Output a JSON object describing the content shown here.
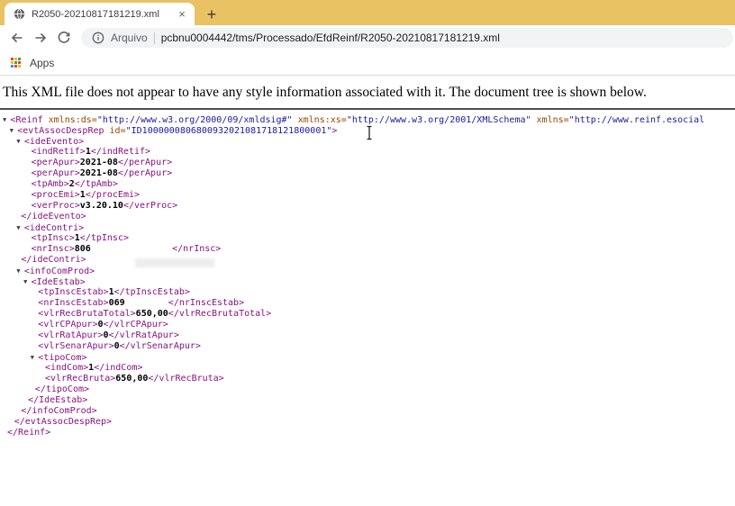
{
  "tab": {
    "title": "R2050-20210817181219.xml",
    "close_glyph": "×",
    "new_tab_glyph": "+"
  },
  "toolbar": {
    "url_scheme_label": "Arquivo",
    "url_path": "pcbnu0004442/tms/Processado/EfdReinf/R2050-20210817181219.xml"
  },
  "bookmarks": {
    "apps_label": "Apps",
    "apps_icon_colors": [
      "#E94335",
      "#FABB05",
      "#34A853",
      "#FABB05",
      "#34A853",
      "#E94335",
      "#4285F4",
      "#E94335",
      "#FABB05"
    ]
  },
  "page": {
    "notice": "This XML file does not appear to have any style information associated with it. The document tree is shown below."
  },
  "theme": {
    "tab_strip_bg": "#E9C264",
    "toolbar_bg": "#FFFFFF",
    "omnibox_bg": "#F1F3F4",
    "divider": "#DADCE0",
    "icon_gray": "#5F6368",
    "url_text": "#202124"
  },
  "xml_tree": {
    "colors": {
      "tag": "#881280",
      "attr_name": "#994500",
      "attr_value": "#1A1AA6",
      "text_node": "#000000"
    },
    "lines": [
      {
        "d": 0,
        "k": "open",
        "arrow": true,
        "p": [
          [
            "tag",
            "<Reinf"
          ],
          [
            "attr",
            " xmlns:ds="
          ],
          [
            "val",
            "\"http://www.w3.org/2000/09/xmldsig#\""
          ],
          [
            "attr",
            " xmlns:xs="
          ],
          [
            "val",
            "\"http://www.w3.org/2001/XMLSchema\""
          ],
          [
            "attr",
            " xmlns="
          ],
          [
            "val",
            "\"http://www.reinf.esocial"
          ]
        ]
      },
      {
        "d": 1,
        "k": "open",
        "arrow": true,
        "p": [
          [
            "tag",
            "<evtAssocDespRep"
          ],
          [
            "attr",
            " id="
          ],
          [
            "val",
            "\"ID1000000806800932021081718121800001\""
          ],
          [
            "tag",
            ">"
          ]
        ]
      },
      {
        "d": 2,
        "k": "open",
        "arrow": true,
        "p": [
          [
            "tag",
            "<ideEvento>"
          ]
        ]
      },
      {
        "d": 3,
        "k": "leaf",
        "p": [
          [
            "tag",
            "<indRetif>"
          ],
          [
            "txt",
            "1"
          ],
          [
            "tag",
            "</indRetif>"
          ]
        ]
      },
      {
        "d": 3,
        "k": "leaf",
        "p": [
          [
            "tag",
            "<perApur>"
          ],
          [
            "txt",
            "2021-08"
          ],
          [
            "tag",
            "</perApur>"
          ]
        ]
      },
      {
        "d": 3,
        "k": "leaf",
        "p": [
          [
            "tag",
            "<perApur>"
          ],
          [
            "txt",
            "2021-08"
          ],
          [
            "tag",
            "</perApur>"
          ]
        ]
      },
      {
        "d": 3,
        "k": "leaf",
        "p": [
          [
            "tag",
            "<tpAmb>"
          ],
          [
            "txt",
            "2"
          ],
          [
            "tag",
            "</tpAmb>"
          ]
        ]
      },
      {
        "d": 3,
        "k": "leaf",
        "p": [
          [
            "tag",
            "<procEmi>"
          ],
          [
            "txt",
            "1"
          ],
          [
            "tag",
            "</procEmi>"
          ]
        ]
      },
      {
        "d": 3,
        "k": "leaf",
        "p": [
          [
            "tag",
            "<verProc>"
          ],
          [
            "txt",
            "v3.20.10"
          ],
          [
            "tag",
            "</verProc>"
          ]
        ]
      },
      {
        "d": 2,
        "k": "close",
        "p": [
          [
            "tag",
            "</ideEvento>"
          ]
        ]
      },
      {
        "d": 2,
        "k": "open",
        "arrow": true,
        "p": [
          [
            "tag",
            "<ideContri>"
          ]
        ]
      },
      {
        "d": 3,
        "k": "leaf",
        "p": [
          [
            "tag",
            "<tpInsc>"
          ],
          [
            "txt",
            "1"
          ],
          [
            "tag",
            "</tpInsc>"
          ]
        ]
      },
      {
        "d": 3,
        "k": "leaf",
        "p": [
          [
            "tag",
            "<nrInsc>"
          ],
          [
            "txt",
            "806"
          ],
          [
            "gap",
            "15"
          ],
          [
            "tag",
            "</nrInsc>"
          ]
        ]
      },
      {
        "d": 2,
        "k": "close",
        "p": [
          [
            "tag",
            "</ideContri>"
          ]
        ]
      },
      {
        "d": 2,
        "k": "open",
        "arrow": true,
        "p": [
          [
            "tag",
            "<infoComProd>"
          ]
        ]
      },
      {
        "d": 3,
        "k": "open",
        "arrow": true,
        "p": [
          [
            "tag",
            "<IdeEstab>"
          ]
        ]
      },
      {
        "d": 4,
        "k": "leaf",
        "p": [
          [
            "tag",
            "<tpInscEstab>"
          ],
          [
            "txt",
            "1"
          ],
          [
            "tag",
            "</tpInscEstab>"
          ]
        ]
      },
      {
        "d": 4,
        "k": "leaf",
        "p": [
          [
            "tag",
            "<nrInscEstab>"
          ],
          [
            "txt",
            "069"
          ],
          [
            "gap",
            "8"
          ],
          [
            "tag",
            "</nrInscEstab>"
          ]
        ]
      },
      {
        "d": 4,
        "k": "leaf",
        "p": [
          [
            "tag",
            "<vlrRecBrutaTotal>"
          ],
          [
            "txt",
            "650,00"
          ],
          [
            "tag",
            "</vlrRecBrutaTotal>"
          ]
        ]
      },
      {
        "d": 4,
        "k": "leaf",
        "p": [
          [
            "tag",
            "<vlrCPApur>"
          ],
          [
            "txt",
            "0"
          ],
          [
            "tag",
            "</vlrCPApur>"
          ]
        ]
      },
      {
        "d": 4,
        "k": "leaf",
        "p": [
          [
            "tag",
            "<vlrRatApur>"
          ],
          [
            "txt",
            "0"
          ],
          [
            "tag",
            "</vlrRatApur>"
          ]
        ]
      },
      {
        "d": 4,
        "k": "leaf",
        "p": [
          [
            "tag",
            "<vlrSenarApur>"
          ],
          [
            "txt",
            "0"
          ],
          [
            "tag",
            "</vlrSenarApur>"
          ]
        ]
      },
      {
        "d": 4,
        "k": "open",
        "arrow": true,
        "p": [
          [
            "tag",
            "<tipoCom>"
          ]
        ]
      },
      {
        "d": 5,
        "k": "leaf",
        "p": [
          [
            "tag",
            "<indCom>"
          ],
          [
            "txt",
            "1"
          ],
          [
            "tag",
            "</indCom>"
          ]
        ]
      },
      {
        "d": 5,
        "k": "leaf",
        "p": [
          [
            "tag",
            "<vlrRecBruta>"
          ],
          [
            "txt",
            "650,00"
          ],
          [
            "tag",
            "</vlrRecBruta>"
          ]
        ]
      },
      {
        "d": 4,
        "k": "close",
        "p": [
          [
            "tag",
            "</tipoCom>"
          ]
        ]
      },
      {
        "d": 3,
        "k": "close",
        "p": [
          [
            "tag",
            "</IdeEstab>"
          ]
        ]
      },
      {
        "d": 2,
        "k": "close",
        "p": [
          [
            "tag",
            "</infoComProd>"
          ]
        ]
      },
      {
        "d": 1,
        "k": "close",
        "p": [
          [
            "tag",
            "</evtAssocDespRep>"
          ]
        ]
      },
      {
        "d": 0,
        "k": "close",
        "p": [
          [
            "tag",
            "</Reinf>"
          ]
        ]
      }
    ]
  }
}
